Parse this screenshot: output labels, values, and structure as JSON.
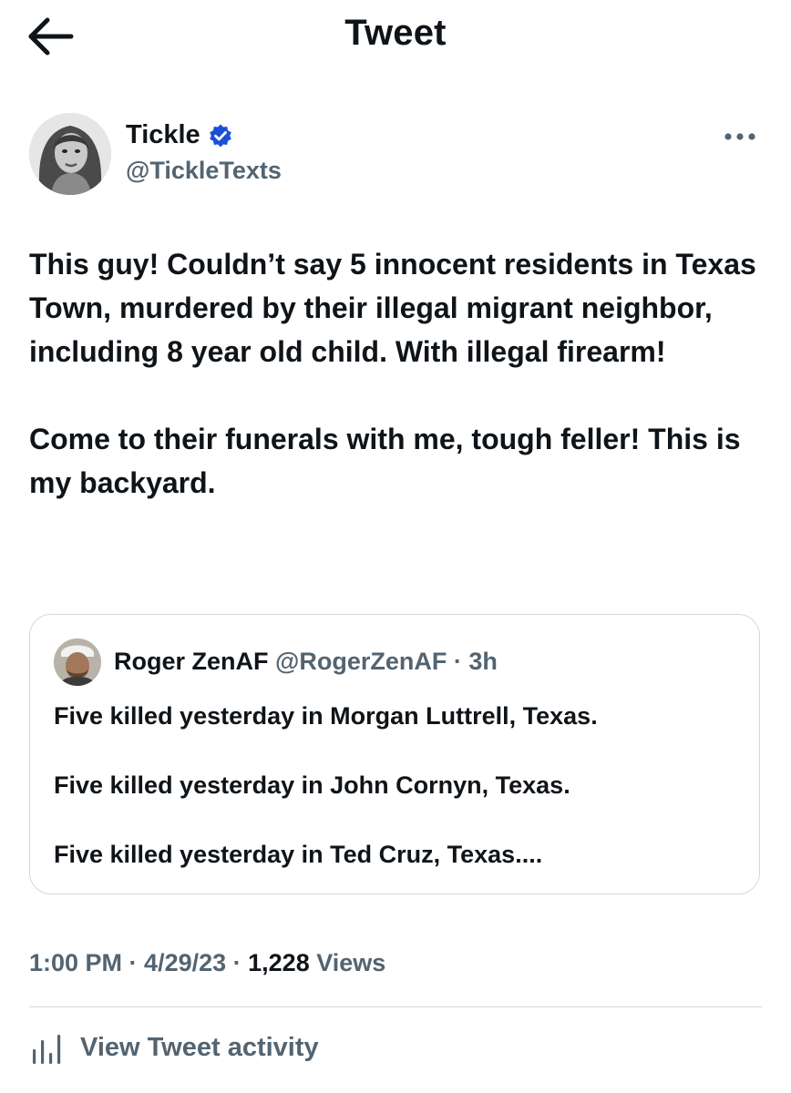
{
  "header": {
    "title": "Tweet",
    "back_icon": "arrow-left-icon"
  },
  "author": {
    "name": "Tickle",
    "handle": "@TickleTexts",
    "verified_color": "#1d4ed8"
  },
  "tweet": {
    "paragraphs": [
      "This guy! Couldn’t say 5 innocent residents in Texas Town, murdered by their illegal migrant neighbor, including 8 year old child. With illegal firearm!",
      "Come to their funerals with me, tough feller! This is my backyard."
    ]
  },
  "quote": {
    "name": "Roger ZenAF",
    "handle": "@RogerZenAF",
    "separator": "·",
    "time": "3h",
    "lines": [
      "Five killed yesterday in Morgan Luttrell, Texas.",
      "Five killed yesterday in John Cornyn, Texas.",
      "Five killed yesterday in Ted Cruz, Texas...."
    ]
  },
  "meta": {
    "time": "1:00 PM",
    "sep": " · ",
    "date": "4/29/23",
    "views_count": "1,228",
    "views_label": " Views"
  },
  "activity": {
    "label": "View Tweet activity",
    "icon": "bar-chart-icon"
  },
  "colors": {
    "text": "#0f1419",
    "secondary": "#536471",
    "border": "#cfd9de"
  }
}
